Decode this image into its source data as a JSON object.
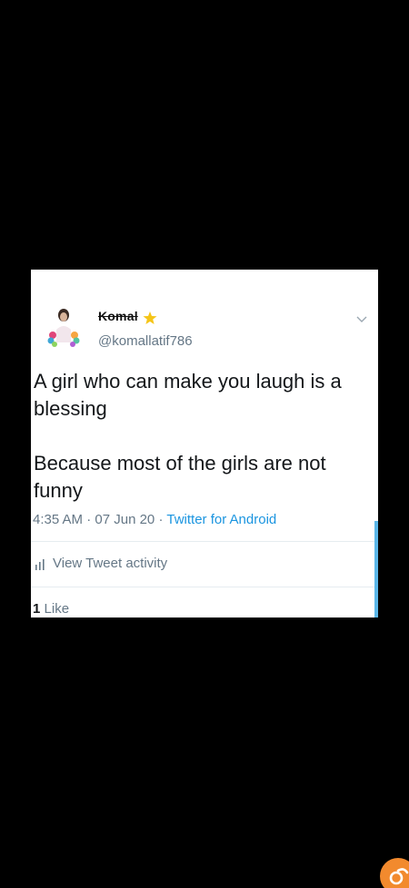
{
  "tweet": {
    "display_name": "Komal",
    "handle": "@komallatif786",
    "text_lines": [
      "A girl who can make you laugh is a blessing",
      "Because most of the girls are not funny"
    ],
    "time": "4:35 AM",
    "date": "07 Jun 20",
    "separator": "·",
    "source": "Twitter for Android",
    "activity_label": "View Tweet activity",
    "like_count": "1",
    "like_label": "Like"
  },
  "icons": {
    "avatar": "avatar",
    "name_badge": "star-icon",
    "menu": "chevron-down-icon",
    "activity": "bar-chart-icon",
    "watermark": "app-logo-icon"
  },
  "colors": {
    "link": "#1b95e0",
    "muted": "#657786",
    "text": "#14171a",
    "logo": "#f28a2e"
  }
}
